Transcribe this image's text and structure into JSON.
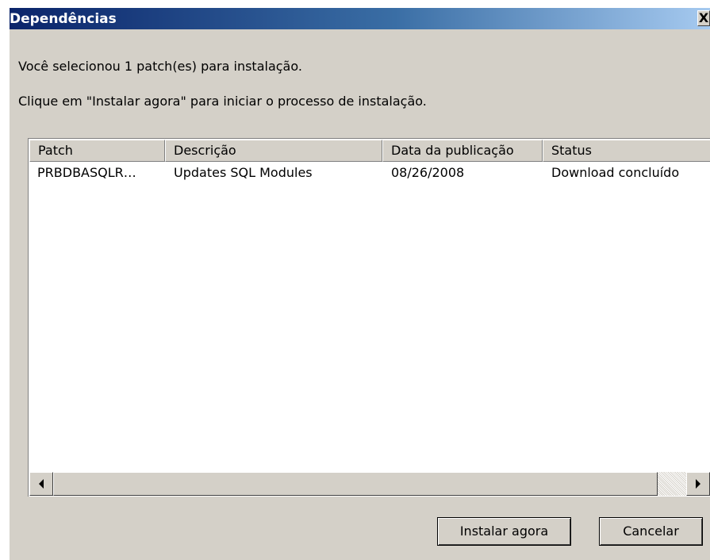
{
  "window": {
    "title": "Dependências",
    "close_glyph": "X"
  },
  "messages": {
    "line1": "Você selecionou 1 patch(es) para instalação.",
    "line2": "Clique em \"Instalar agora\" para iniciar o processo de instalação."
  },
  "table": {
    "columns": [
      "Patch",
      "Descrição",
      "Data da publicação",
      "Status"
    ],
    "rows": [
      [
        "PRBDBASQLR…",
        "Updates SQL Modules",
        "08/26/2008",
        "Download concluído"
      ]
    ]
  },
  "buttons": {
    "install": "Instalar agora",
    "cancel": "Cancelar"
  },
  "colors": {
    "dialog_face": "#d4d0c8",
    "titlebar_start": "#0a246a",
    "titlebar_end": "#a6caf0"
  }
}
